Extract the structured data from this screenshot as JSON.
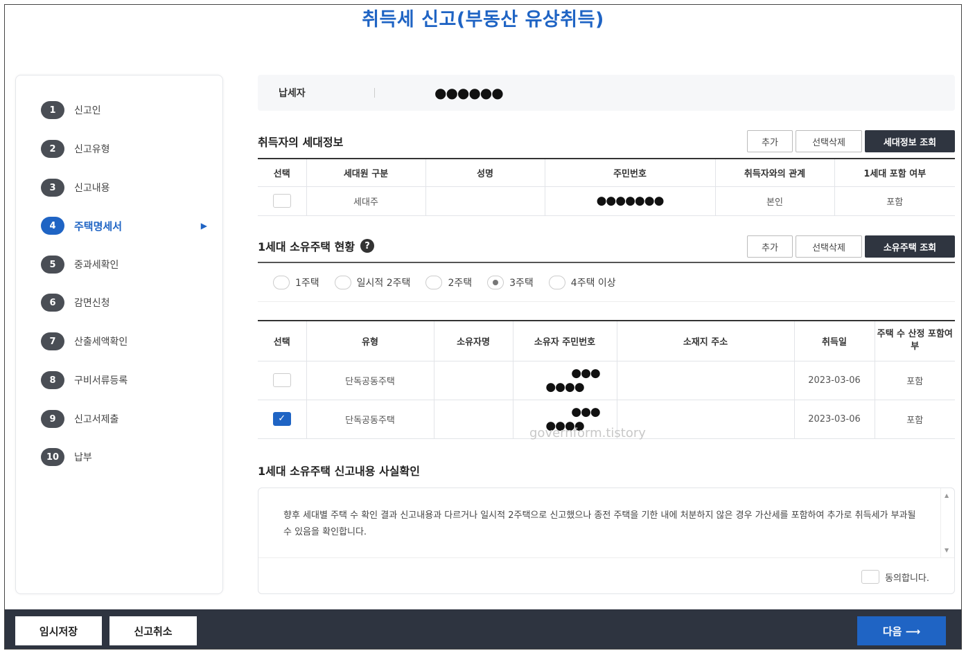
{
  "title": "취득세 신고(부동산 유상취득)",
  "steps": [
    {
      "num": "1",
      "label": "신고인"
    },
    {
      "num": "2",
      "label": "신고유형"
    },
    {
      "num": "3",
      "label": "신고내용"
    },
    {
      "num": "4",
      "label": "주택명세서"
    },
    {
      "num": "5",
      "label": "중과세확인"
    },
    {
      "num": "6",
      "label": "감면신청"
    },
    {
      "num": "7",
      "label": "산출세액확인"
    },
    {
      "num": "8",
      "label": "구비서류등록"
    },
    {
      "num": "9",
      "label": "신고서제출"
    },
    {
      "num": "10",
      "label": "납부"
    }
  ],
  "active_step_arrow": "▶",
  "taxpayer": {
    "label": "납세자",
    "value": "●●●●●●"
  },
  "household": {
    "title": "취득자의 세대정보",
    "buttons": {
      "add": "추가",
      "delete": "선택삭제",
      "lookup": "세대정보 조회"
    },
    "headers": [
      "선택",
      "세대원 구분",
      "성명",
      "주민번호",
      "취득자와의 관계",
      "1세대 포함 여부"
    ],
    "rows": [
      {
        "type": "세대주",
        "name": "",
        "id": "●●●●●●●",
        "relation": "본인",
        "included": "포함"
      }
    ]
  },
  "owned": {
    "title": "1세대 소유주택 현황",
    "help_icon": "?",
    "buttons": {
      "add": "추가",
      "delete": "선택삭제",
      "lookup": "소유주택 조회"
    },
    "radios": [
      "1주택",
      "일시적 2주택",
      "2주택",
      "3주택",
      "4주택 이상"
    ],
    "selected_radio": "3주택",
    "headers": [
      "선택",
      "유형",
      "소유자명",
      "소유자 주민번호",
      "소재지 주소",
      "취득일",
      "주택 수 산정 포함여부"
    ],
    "rows": [
      {
        "checked": false,
        "type": "단독공동주택",
        "owner": "",
        "id_line1": "●●●",
        "id_line2": "●●●●",
        "address": "",
        "date": "2023-03-06",
        "included": "포함"
      },
      {
        "checked": true,
        "type": "단독공동주택",
        "owner": "",
        "id_line1": "●●●",
        "id_line2": "●●●●",
        "address": "",
        "date": "2023-03-06",
        "included": "포함"
      }
    ]
  },
  "confirm": {
    "title": "1세대 소유주택 신고내용 사실확인",
    "text": "향후 세대별 주택 수 확인 결과 신고내용과 다르거나 일시적 2주택으로 신고했으나 종전 주택을 기한 내에 처분하지 않은 경우 가산세를 포함하여 추가로 취득세가 부과될 수 있음을 확인합니다.",
    "agree": "동의합니다."
  },
  "watermark": "governform.tistory",
  "footer": {
    "save": "임시저장",
    "cancel": "신고취소",
    "next": "다음 ⟶"
  }
}
